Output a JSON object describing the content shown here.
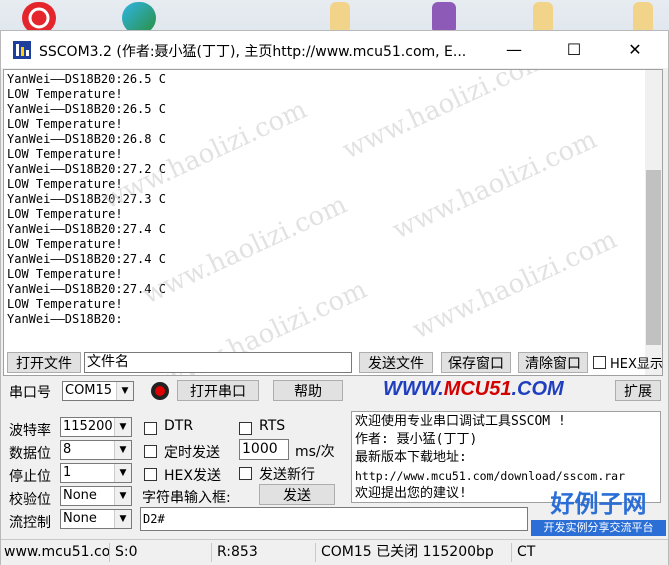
{
  "desktop": {
    "icons": [
      "netease-music-icon",
      "edge-browser-icon",
      "folder-icon",
      "winrar-icon",
      "folder-icon",
      "folder-icon"
    ]
  },
  "window": {
    "title": "SSCOM3.2 (作者:聂小猛(丁丁), 主页http://www.mcu51.com,  E...",
    "controls": {
      "minimize": "—",
      "maximize": "☐",
      "close": "✕"
    }
  },
  "receive": {
    "lines": [
      "YanWei——DS18B20:26.5 C",
      "LOW Temperature!",
      "YanWei——DS18B20:26.5 C",
      "LOW Temperature!",
      "YanWei——DS18B20:26.8 C",
      "LOW Temperature!",
      "YanWei——DS18B20:27.2 C",
      "LOW Temperature!",
      "YanWei——DS18B20:27.3 C",
      "LOW Temperature!",
      "YanWei——DS18B20:27.4 C",
      "LOW Temperature!",
      "YanWei——DS18B20:27.4 C",
      "LOW Temperature!",
      "YanWei——DS18B20:27.4 C",
      "LOW Temperature!",
      "YanWei——DS18B20:"
    ]
  },
  "watermark": "www.haolizi.com",
  "file_row": {
    "open_file": "打开文件",
    "file_name": "文件名",
    "send_file": "发送文件",
    "save_window": "保存窗口",
    "clear_window": "清除窗口",
    "hex_display": "HEX显示"
  },
  "port_row": {
    "port_label": "串口号",
    "port_value": "COM15",
    "open_port": "打开串口",
    "help": "帮助",
    "brand_prefix": "WWW.",
    "brand_mid": "MCU51",
    "brand_suffix": ".COM",
    "expand": "扩展"
  },
  "settings": {
    "baud_label": "波特率",
    "baud_value": "115200",
    "data_label": "数据位",
    "data_value": "8",
    "stop_label": "停止位",
    "stop_value": "1",
    "parity_label": "校验位",
    "parity_value": "None",
    "flow_label": "流控制",
    "flow_value": "None"
  },
  "options": {
    "dtr": "DTR",
    "rts": "RTS",
    "timed_send": "定时发送",
    "interval_value": "1000",
    "interval_unit": "ms/次",
    "hex_send": "HEX发送",
    "send_newline": "发送新行",
    "input_label": "字符串输入框:",
    "send": "发送",
    "input_value": "D2#"
  },
  "info": {
    "lines": [
      "欢迎使用专业串口调试工具SSCOM !",
      "作者: 聂小猛(丁丁)",
      "最新版本下载地址:",
      "http://www.mcu51.com/download/sscom.rar",
      "欢迎提出您的建议!"
    ]
  },
  "statusbar": {
    "site": "www.mcu51.cor",
    "sent": "S:0",
    "received": "R:853",
    "port_state": "COM15 已关闭  115200bp",
    "cts": "CT"
  },
  "site_logo": {
    "title": "好例子网",
    "subtitle": "开发实例分享交流平台"
  },
  "colors": {
    "brand_blue": "#1f3fbf",
    "brand_red": "#d40000",
    "logo_blue": "#2b6fd6"
  }
}
